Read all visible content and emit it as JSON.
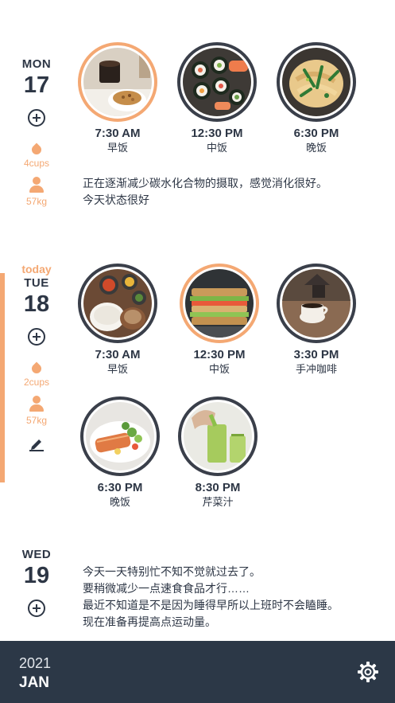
{
  "days": [
    {
      "dow": "MON",
      "date": "17",
      "water": "4cups",
      "weight": "57kg",
      "meals": [
        {
          "time": "7:30 AM",
          "name": "早饭",
          "highlight": true,
          "image": "breakfast-coffee-granola"
        },
        {
          "time": "12:30 PM",
          "name": "中饭",
          "highlight": false,
          "image": "sushi-rolls"
        },
        {
          "time": "6:30 PM",
          "name": "晚饭",
          "highlight": false,
          "image": "pasta-greens"
        }
      ],
      "note_lines": [
        "正在逐渐减少碳水化合物的摄取，感觉消化很好。",
        "今天状态很好"
      ]
    },
    {
      "today_label": "today",
      "dow": "TUE",
      "date": "18",
      "water": "2cups",
      "weight": "57kg",
      "meals": [
        {
          "time": "7:30 AM",
          "name": "早饭",
          "highlight": false,
          "image": "rice-side-dishes"
        },
        {
          "time": "12:30 PM",
          "name": "中饭",
          "highlight": true,
          "image": "sandwich"
        },
        {
          "time": "3:30 PM",
          "name": "手冲咖啡",
          "highlight": false,
          "image": "pour-over-coffee"
        },
        {
          "time": "6:30 PM",
          "name": "晚饭",
          "highlight": false,
          "image": "salmon-salad"
        },
        {
          "time": "8:30 PM",
          "name": "芹菜汁",
          "highlight": false,
          "image": "celery-juice"
        }
      ]
    },
    {
      "dow": "WED",
      "date": "19",
      "note_lines": [
        "今天一天特别忙不知不觉就过去了。",
        "要稍微减少一点速食食品才行……",
        "最近不知道是不是因为睡得早所以上班时不会瞌睡。",
        "现在准备再提高点运动量。"
      ]
    }
  ],
  "footer": {
    "year": "2021",
    "month": "JAN"
  },
  "icons": {
    "add": "plus-circle-icon",
    "water": "water-drop-icon",
    "weight": "person-icon",
    "edit": "pencil-icon",
    "settings": "gear-icon"
  },
  "colors": {
    "accent": "#f4a873",
    "dark": "#2c3847",
    "ring": "#3a3f4a"
  }
}
